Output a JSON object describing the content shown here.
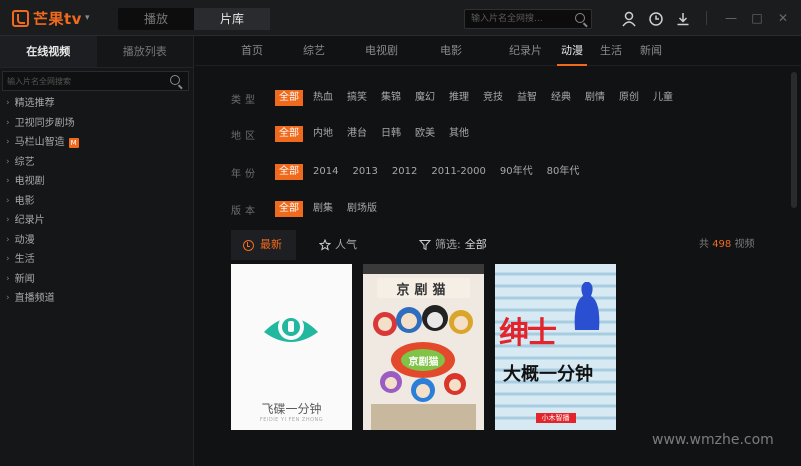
{
  "app": {
    "logo_text": "芒果tv",
    "logo_caret": "▾"
  },
  "mode_switch": {
    "tabs": [
      "播放",
      "片库"
    ],
    "active": 1
  },
  "top_search": {
    "placeholder": "输入片名全网搜..."
  },
  "window_controls": {
    "minimize": "—",
    "maximize": "□",
    "close": "✕"
  },
  "sidebar": {
    "tabs": [
      "在线视频",
      "播放列表"
    ],
    "active_tab": 0,
    "search_placeholder": "输入片名全网搜索",
    "items": [
      {
        "label": "精选推荐"
      },
      {
        "label": "卫视同步剧场"
      },
      {
        "label": "马栏山智造",
        "badge": "M"
      },
      {
        "label": "综艺"
      },
      {
        "label": "电视剧"
      },
      {
        "label": "电影"
      },
      {
        "label": "纪录片"
      },
      {
        "label": "动漫"
      },
      {
        "label": "生活"
      },
      {
        "label": "新闻"
      },
      {
        "label": "直播频道"
      }
    ]
  },
  "nav": {
    "items": [
      "首页",
      "综艺",
      "电视剧",
      "电影",
      "纪录片",
      "动漫",
      "生活",
      "新闻"
    ],
    "active": 5
  },
  "filters": {
    "type": {
      "label": "类型",
      "options": [
        "全部",
        "热血",
        "搞笑",
        "集锦",
        "魔幻",
        "推理",
        "竞技",
        "益智",
        "经典",
        "剧情",
        "原创",
        "儿童"
      ],
      "selected": 0
    },
    "region": {
      "label": "地区",
      "options": [
        "全部",
        "内地",
        "港台",
        "日韩",
        "欧美",
        "其他"
      ],
      "selected": 0
    },
    "year": {
      "label": "年份",
      "options": [
        "全部",
        "2014",
        "2013",
        "2012",
        "2011-2000",
        "90年代",
        "80年代"
      ],
      "selected": 0
    },
    "edition": {
      "label": "版本",
      "options": [
        "全部",
        "剧集",
        "剧场版"
      ],
      "selected": 0
    }
  },
  "sort": {
    "latest": "最新",
    "popular": "人气",
    "filter_label": "筛选:",
    "filter_value": "全部",
    "total_prefix": "共",
    "total_count": "498",
    "total_suffix": "视频"
  },
  "posters": [
    {
      "title": "飞碟一分钟",
      "subtitle": "FEIDIE YI FEN ZHONG"
    },
    {
      "top_text": "京剧猫",
      "bottom_text": "京剧猫"
    },
    {
      "title": "绅士",
      "subtitle": "大概一分钟",
      "footer": "小木智播"
    }
  ],
  "watermark": "www.wmzhe.com",
  "colors": {
    "accent": "#f06a1e",
    "background": "#111214",
    "sidebar": "#151618"
  }
}
